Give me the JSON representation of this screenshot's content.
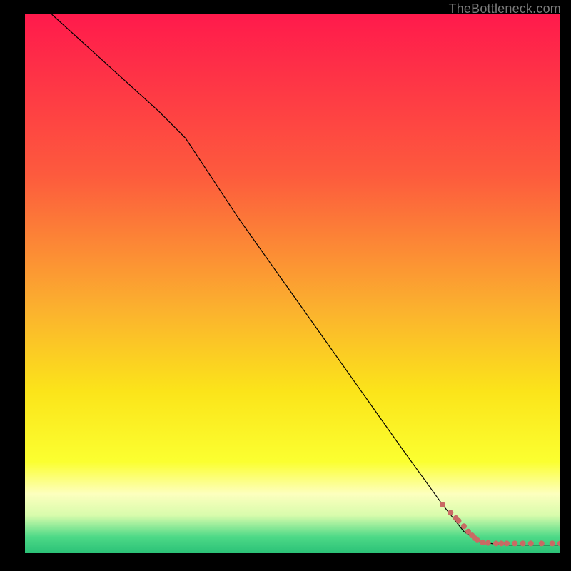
{
  "attribution": "TheBottleneck.com",
  "chart_data": {
    "type": "line",
    "title": "",
    "xlabel": "",
    "ylabel": "",
    "xlim": [
      0,
      100
    ],
    "ylim": [
      0,
      100
    ],
    "background_gradient": {
      "stops": [
        {
          "pos": 0.0,
          "color": "#ff1a4c"
        },
        {
          "pos": 0.3,
          "color": "#fd5b3d"
        },
        {
          "pos": 0.55,
          "color": "#fbb22e"
        },
        {
          "pos": 0.7,
          "color": "#fbe41a"
        },
        {
          "pos": 0.83,
          "color": "#fbff30"
        },
        {
          "pos": 0.89,
          "color": "#fdffbe"
        },
        {
          "pos": 0.93,
          "color": "#d8fcac"
        },
        {
          "pos": 0.97,
          "color": "#4dd987"
        },
        {
          "pos": 1.0,
          "color": "#2bc177"
        }
      ]
    },
    "series": [
      {
        "name": "bottleneck-curve",
        "type": "line",
        "color": "#000000",
        "stroke_width": 1.2,
        "x": [
          5,
          15,
          25,
          30,
          40,
          50,
          60,
          70,
          78,
          82,
          85,
          90,
          95,
          100
        ],
        "y": [
          100,
          91,
          82,
          77,
          62,
          48,
          34,
          20,
          9,
          4,
          2,
          1.5,
          1.5,
          1.5
        ]
      },
      {
        "name": "optimal-range-points",
        "type": "scatter",
        "color": "#c96a64",
        "marker_radius": 4,
        "x": [
          78,
          79.5,
          80.5,
          81,
          82,
          82.8,
          83.5,
          84,
          84.5,
          85.5,
          86.5,
          88,
          89,
          90,
          91.5,
          93,
          94.5,
          96.5,
          98.5,
          100
        ],
        "y": [
          9,
          7.5,
          6.5,
          6,
          5,
          4,
          3.3,
          2.8,
          2.4,
          2,
          1.9,
          1.8,
          1.8,
          1.8,
          1.8,
          1.8,
          1.8,
          1.8,
          1.8,
          1.8
        ]
      }
    ]
  }
}
